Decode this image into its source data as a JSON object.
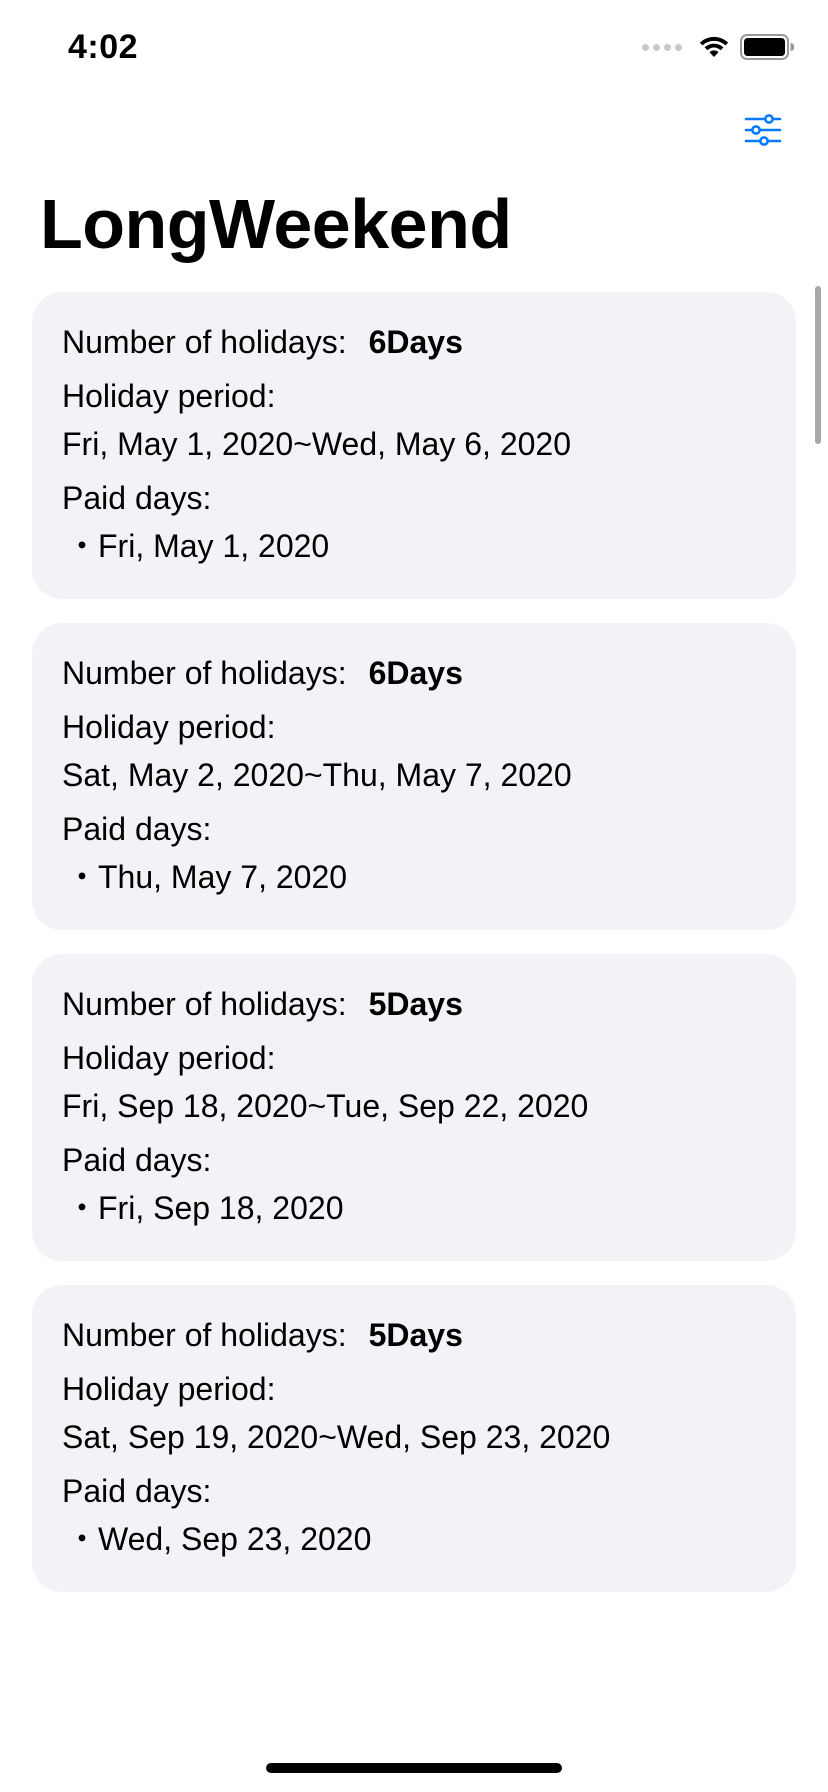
{
  "status_bar": {
    "time": "4:02"
  },
  "header": {
    "title": "LongWeekend",
    "settings_icon": "sliders-icon"
  },
  "labels": {
    "holidays": "Number of holidays:",
    "period": "Holiday period:",
    "paid": "Paid days:"
  },
  "cards": [
    {
      "count": "6Days",
      "period": "Fri, May 1, 2020~Wed, May 6, 2020",
      "paid_days": [
        "・Fri, May 1, 2020"
      ]
    },
    {
      "count": "6Days",
      "period": "Sat, May 2, 2020~Thu, May 7, 2020",
      "paid_days": [
        "・Thu, May 7, 2020"
      ]
    },
    {
      "count": "5Days",
      "period": "Fri, Sep 18, 2020~Tue, Sep 22, 2020",
      "paid_days": [
        "・Fri, Sep 18, 2020"
      ]
    },
    {
      "count": "5Days",
      "period": "Sat, Sep 19, 2020~Wed, Sep 23, 2020",
      "paid_days": [
        "・Wed, Sep 23, 2020"
      ]
    }
  ],
  "colors": {
    "accent": "#0a7aff",
    "card_background": "#f2f2f7"
  }
}
